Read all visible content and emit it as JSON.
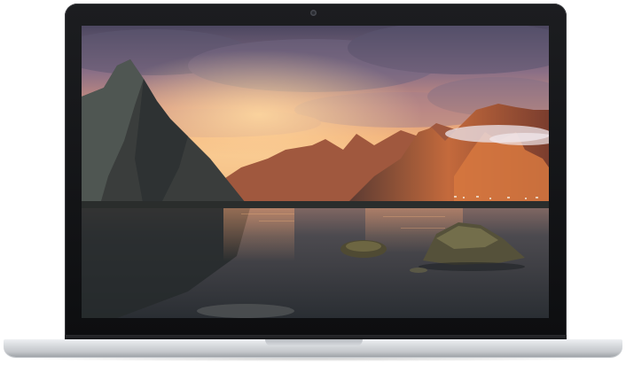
{
  "device": {
    "icon": "laptop-icon",
    "wallpaper": {
      "icon": "mountain-lake-sunset-icon",
      "colors": {
        "sky_top": "#5a4f6b",
        "sky_glow": "#f0a070",
        "mountain_dark": "#2d3134",
        "mountain_lit": "#c0643a",
        "water": "#3a3e44"
      }
    },
    "colors": {
      "bezel": "#111214",
      "chassis": "#d7dadd"
    }
  }
}
